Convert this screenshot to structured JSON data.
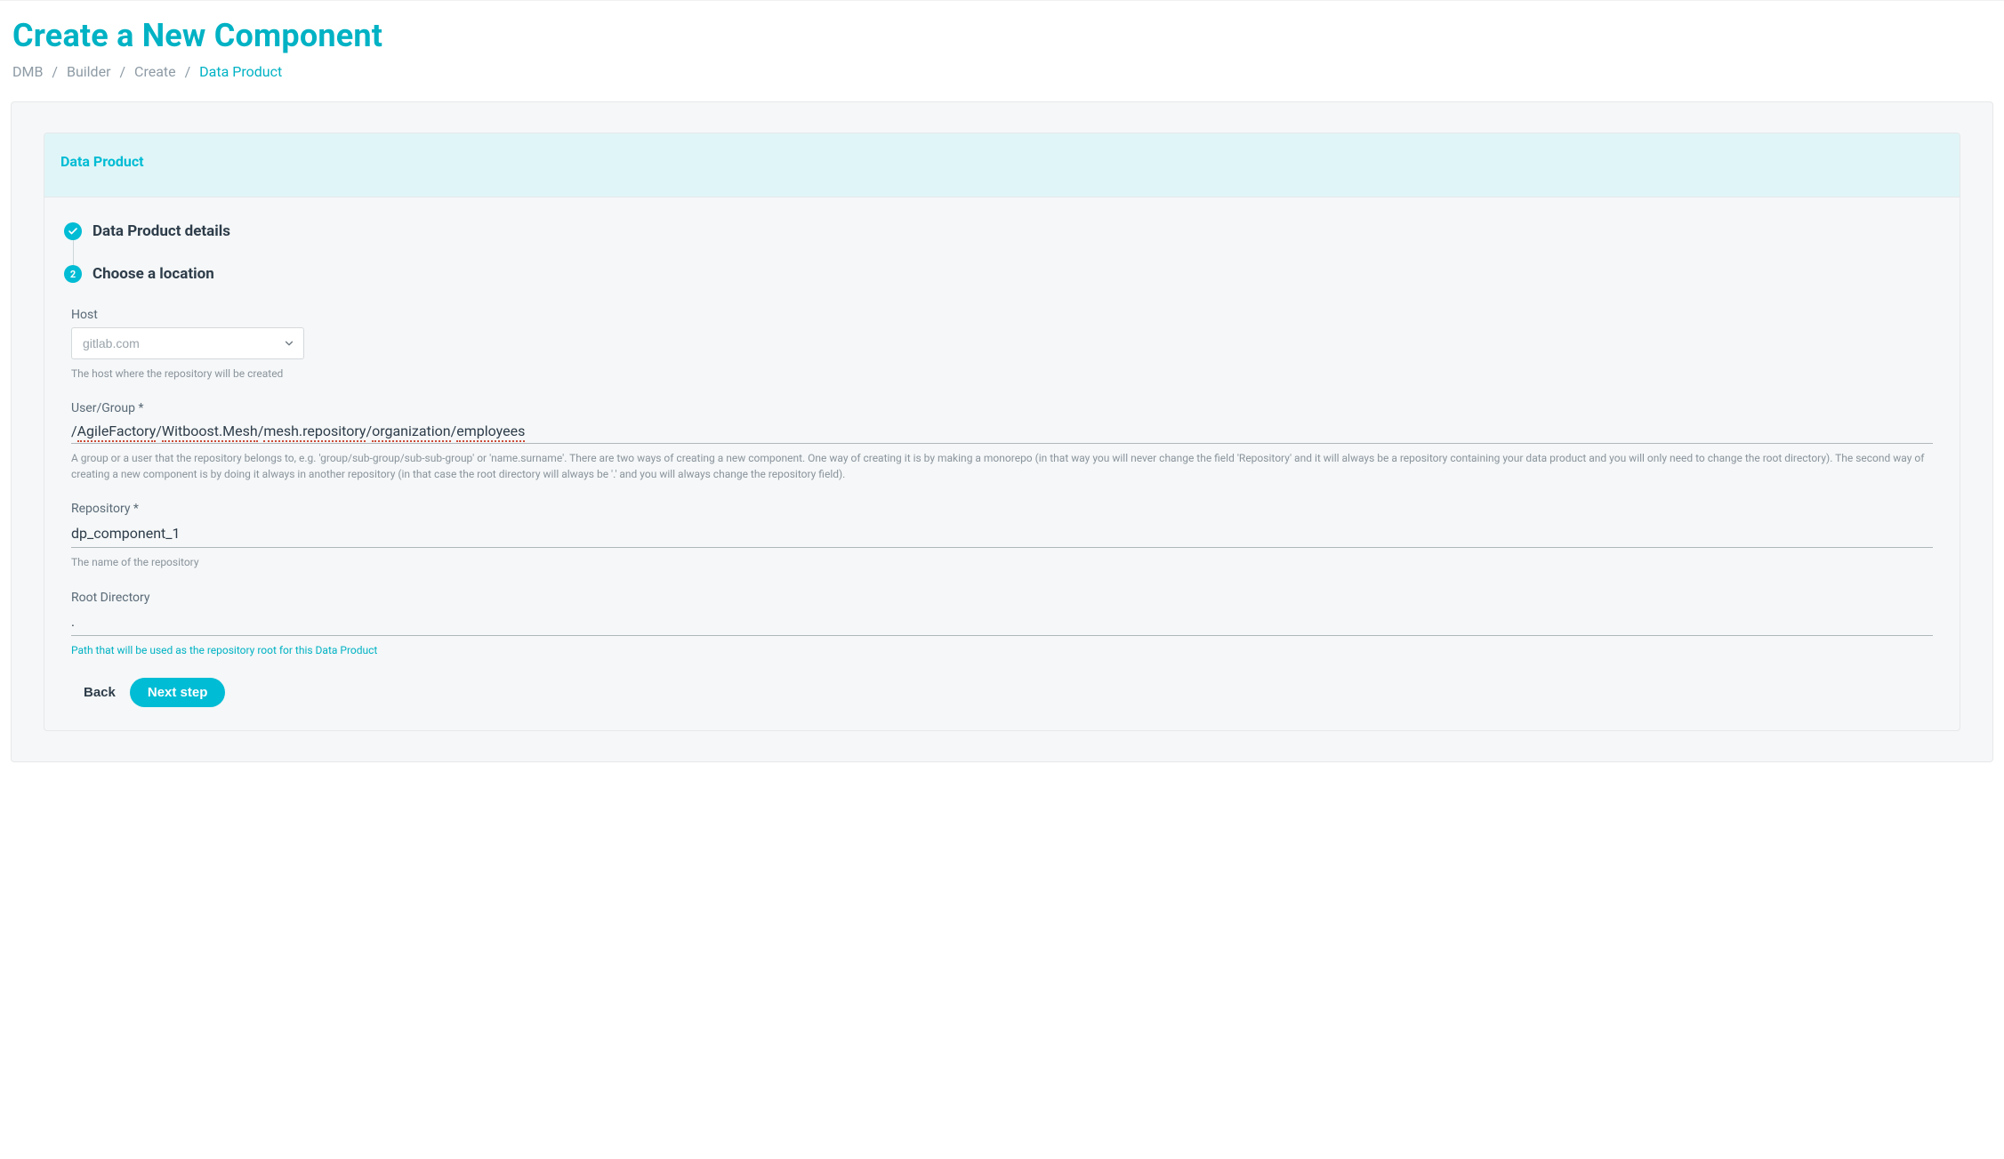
{
  "page": {
    "title": "Create a New Component"
  },
  "breadcrumb": {
    "items": [
      "DMB",
      "Builder",
      "Create",
      "Data Product"
    ]
  },
  "card": {
    "header": "Data Product"
  },
  "steps": {
    "step1": {
      "label": "Data Product details",
      "completed": true
    },
    "step2": {
      "label": "Choose a location",
      "number": "2"
    }
  },
  "form": {
    "host": {
      "label": "Host",
      "value": "gitlab.com",
      "help": "The host where the repository will be created"
    },
    "userGroup": {
      "label": "User/Group",
      "segments": [
        "AgileFactory",
        "Witboost.Mesh",
        "mesh.repository",
        "organization",
        "employees"
      ],
      "help": "A group or a user that the repository belongs to, e.g. 'group/sub-group/sub-sub-group' or 'name.surname'. There are two ways of creating a new component. One way of creating it is by making a monorepo (in that way you will never change the field 'Repository' and it will always be a repository containing your data product and you will only need to change the root directory). The second way of creating a new component is by doing it always in another repository (in that case the root directory will always be '.' and you will always change the repository field)."
    },
    "repository": {
      "label": "Repository",
      "value": "dp_component_1",
      "help": "The name of the repository"
    },
    "rootDirectory": {
      "label": "Root Directory",
      "value": ".",
      "help": "Path that will be used as the repository root for this Data Product"
    }
  },
  "actions": {
    "back": "Back",
    "next": "Next step"
  }
}
